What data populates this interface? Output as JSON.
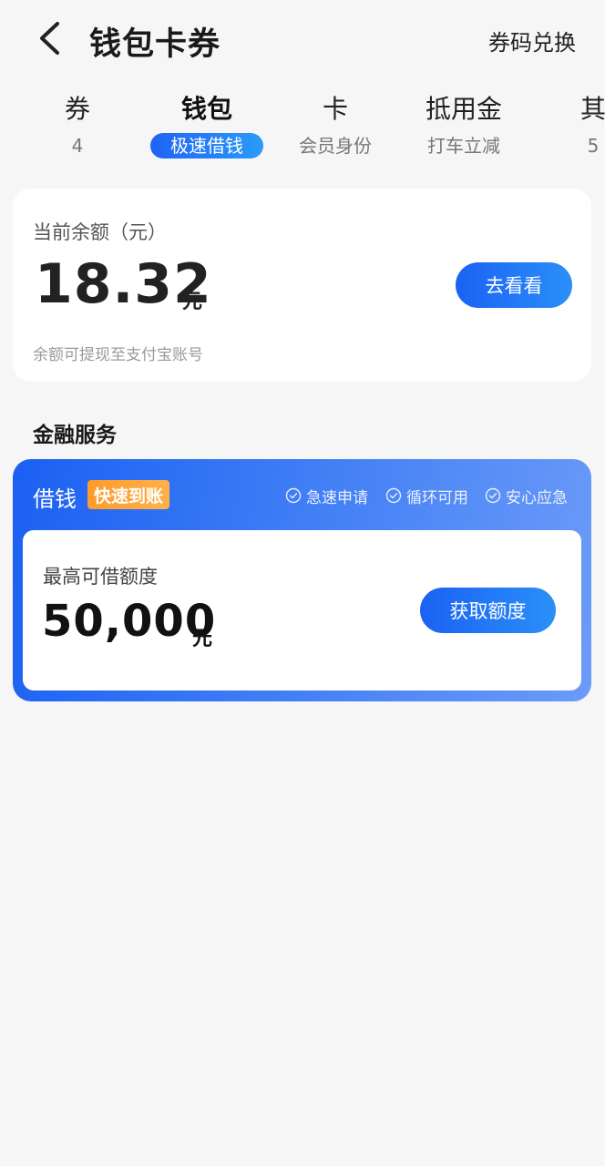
{
  "header": {
    "title": "钱包卡券",
    "back_icon": "chevron-left-icon",
    "redeem_label": "券码兑换"
  },
  "tabs": [
    {
      "label": "券",
      "sub": "4"
    },
    {
      "label": "钱包",
      "sub": "极速借钱",
      "active": true
    },
    {
      "label": "卡",
      "sub": "会员身份"
    },
    {
      "label": "抵用金",
      "sub": "打车立减"
    },
    {
      "label": "其",
      "sub": "5"
    }
  ],
  "balance": {
    "label": "当前余额（元）",
    "value": "18.32",
    "unit": "元",
    "button_label": "去看看",
    "note": "余额可提现至支付宝账号"
  },
  "section": {
    "title": "金融服务"
  },
  "loan": {
    "title": "借钱",
    "badge": "快速到账",
    "features": [
      "急速申请",
      "循环可用",
      "安心应急"
    ],
    "feature_icon": "check-circle-icon",
    "credit_label": "最高可借额度",
    "credit_value": "50,000",
    "credit_unit": "元",
    "button_label": "获取额度"
  },
  "colors": {
    "accent": "#1f63f5",
    "accent_light": "#2a9bf8",
    "badge": "#ff9b2b",
    "background": "#f6f6f6"
  }
}
